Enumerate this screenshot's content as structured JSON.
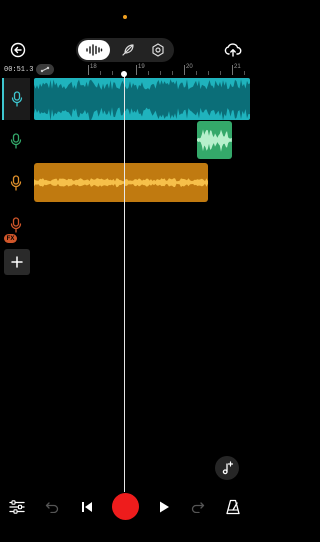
{
  "colors": {
    "accent": "#ffffff",
    "track1": "#1fb3bd",
    "track2": "#34a86a",
    "track3": "#c07a10",
    "track4": "#d0562a",
    "record": "#ee1c1c"
  },
  "header": {
    "back_icon": "arrow-left-icon",
    "modes": [
      "waveform-icon",
      "feather-icon",
      "settings-hexagon-icon"
    ],
    "active_mode": "waveform",
    "cloud_icon": "cloud-upload-icon"
  },
  "timeline": {
    "time_readout": "00:51.3",
    "loop_icon": "loop-icon",
    "ruler_labels": [
      "18",
      "19",
      "20",
      "21"
    ]
  },
  "tracks": [
    {
      "icon": "microphone-icon",
      "color": "#3ec6cf",
      "selected": true
    },
    {
      "icon": "microphone-icon",
      "color": "#34a86a",
      "selected": false
    },
    {
      "icon": "microphone-icon",
      "color": "#e0902a",
      "selected": false
    },
    {
      "icon": "microphone-icon",
      "color": "#d0562a",
      "selected": false,
      "badge": "FX"
    }
  ],
  "add_track_icon": "plus-icon",
  "floating_button_icon": "music-note-add-icon",
  "transport": {
    "mixer_icon": "sliders-icon",
    "undo_icon": "undo-icon",
    "skip_back_icon": "skip-back-icon",
    "record_icon": "record-icon",
    "play_icon": "play-icon",
    "redo_icon": "redo-icon",
    "metronome_icon": "metronome-icon"
  }
}
